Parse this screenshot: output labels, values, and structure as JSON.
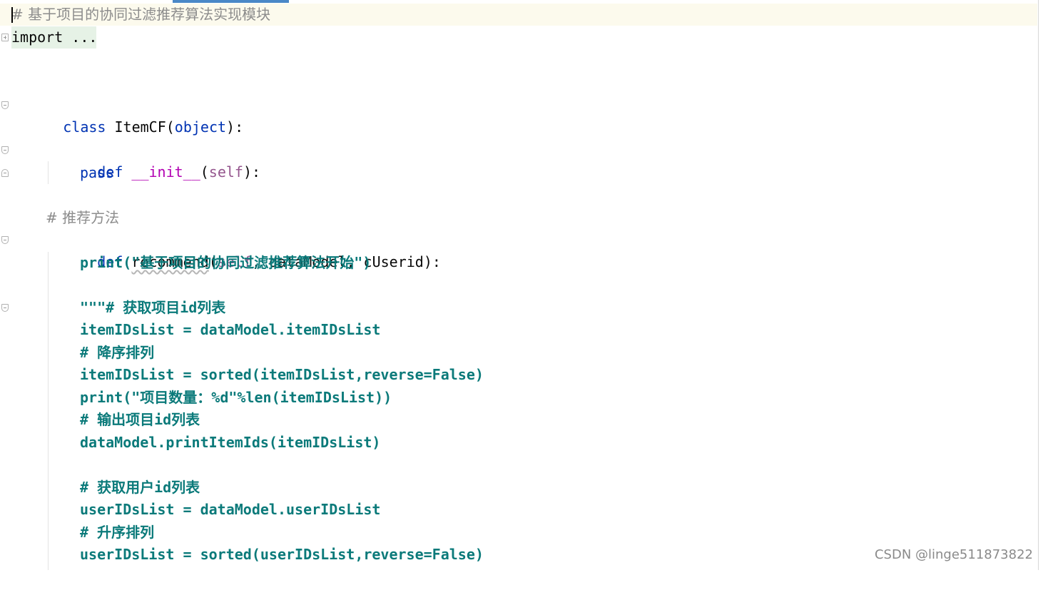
{
  "editor": {
    "file_comment": "# 基于项目的协同过滤推荐算法实现模块",
    "import_fold": "import ...",
    "class_kw": "class",
    "class_name": " ItemCF(",
    "class_base": "object",
    "class_end": "):",
    "def_kw": "def",
    "init_name": "__init__",
    "paren_open": "(",
    "self_kw": "self",
    "init_end": "):",
    "pass_kw": "pass",
    "recommend_comment": "# 推荐方法",
    "recommend_name": "recommend",
    "recommend_params": ", dataModel, cUserid):",
    "print_start": "print(\"基于项目的协同过滤推荐算法开始\")",
    "doc_open": "\"\"\"# 获取项目id列表",
    "line_item_ids": "itemIDsList = dataModel.itemIDsList",
    "comment_desc": "# 降序排列",
    "line_sort_items": "itemIDsList = sorted(itemIDsList,reverse=False)",
    "line_print_count": "print(\"项目数量：%d\"%len(itemIDsList))",
    "comment_output_items": "# 输出项目id列表",
    "line_print_item_ids": "dataModel.printItemIds(itemIDsList)",
    "comment_get_users": "# 获取用户id列表",
    "line_user_ids": "userIDsList = dataModel.userIDsList",
    "comment_asc": "# 升序排列",
    "line_sort_users": "userIDsList = sorted(userIDsList,reverse=False)"
  },
  "watermark": "CSDN @linge511873822",
  "colors": {
    "keyword": "#0033b3",
    "comment": "#8c8c8c",
    "magic_method": "#b200b2",
    "self": "#94558d",
    "docstring": "#0b7a7a",
    "tab_indicator": "#4a88c7",
    "caret_row": "#fcfaed",
    "fold_region": "#e6f2e6"
  },
  "icons": [
    "fold-expand-icon",
    "fold-collapse-icon",
    "text-caret"
  ]
}
